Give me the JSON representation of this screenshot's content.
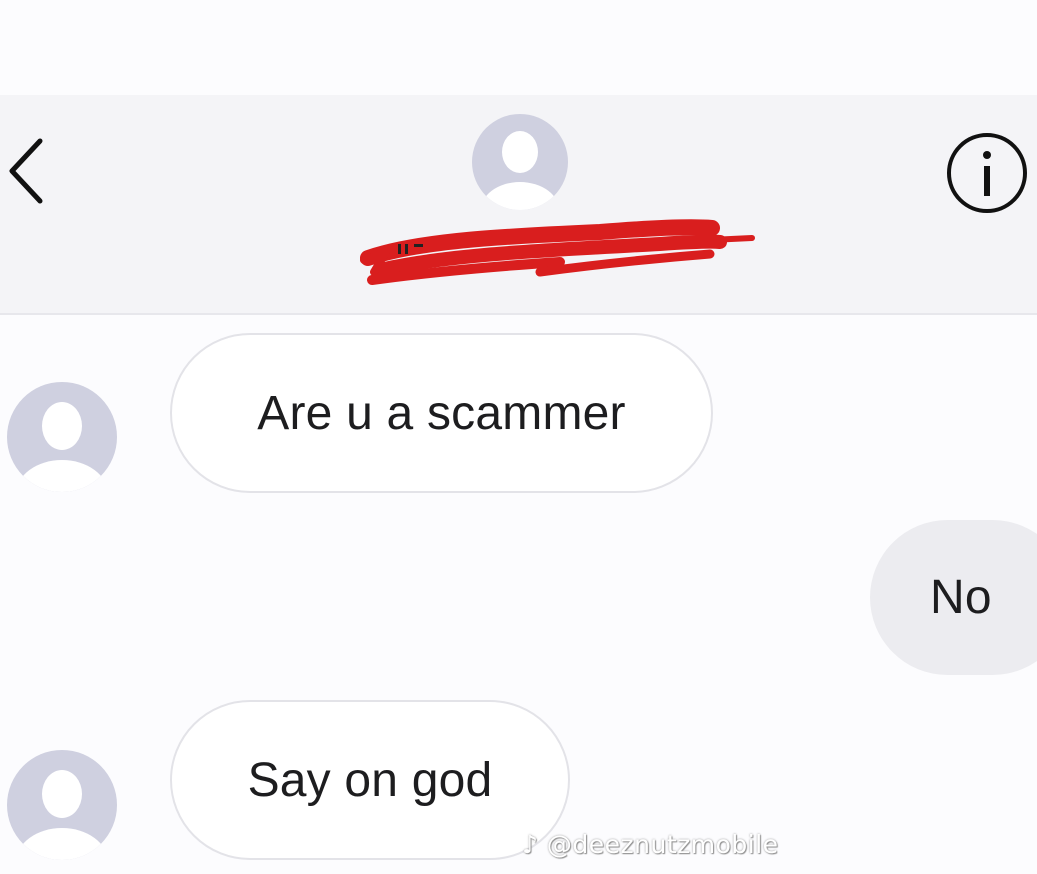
{
  "header": {
    "contact_name": "u",
    "back_icon": "chevron-left-icon",
    "info_icon": "info-icon"
  },
  "messages": [
    {
      "direction": "incoming",
      "text": "Are u a scammer"
    },
    {
      "direction": "outgoing",
      "text": "No"
    },
    {
      "direction": "incoming",
      "text": "Say on god"
    }
  ],
  "watermark": {
    "text": "♪ @deeznutzmobile"
  },
  "colors": {
    "redaction": "#d91e1e",
    "avatar_bg": "#cfd0e0",
    "avatar_fg": "#ffffff",
    "incoming_bubble": "#ffffff",
    "outgoing_bubble": "#ececf0"
  }
}
